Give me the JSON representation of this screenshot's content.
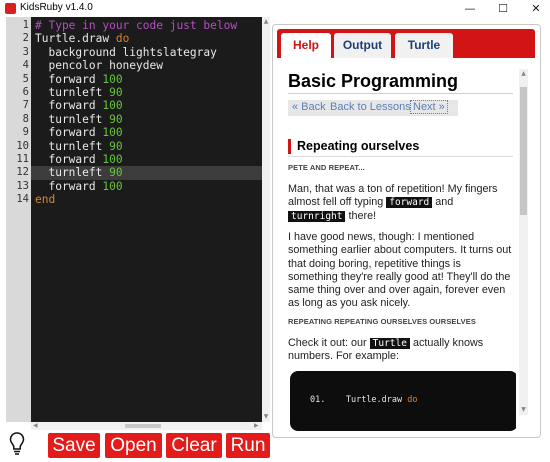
{
  "window": {
    "title": "KidsRuby v1.4.0",
    "controls": {
      "minimize": "—",
      "maximize": "☐",
      "close": "✕"
    }
  },
  "editor": {
    "line_numbers": [
      "1",
      "2",
      "3",
      "4",
      "5",
      "6",
      "7",
      "8",
      "9",
      "10",
      "11",
      "12",
      "13",
      "14"
    ],
    "lines": [
      [
        {
          "t": "# Type in your code just below",
          "c": "comment"
        }
      ],
      [
        {
          "t": "Turtle.draw ",
          "c": "plain"
        },
        {
          "t": "do",
          "c": "keyword"
        }
      ],
      [
        {
          "t": "  background lightslategray",
          "c": "plain"
        }
      ],
      [
        {
          "t": "  pencolor honeydew",
          "c": "plain"
        }
      ],
      [
        {
          "t": "  forward ",
          "c": "plain"
        },
        {
          "t": "100",
          "c": "number"
        }
      ],
      [
        {
          "t": "  turnleft ",
          "c": "plain"
        },
        {
          "t": "90",
          "c": "number"
        }
      ],
      [
        {
          "t": "  forward ",
          "c": "plain"
        },
        {
          "t": "100",
          "c": "number"
        }
      ],
      [
        {
          "t": "  turnleft ",
          "c": "plain"
        },
        {
          "t": "90",
          "c": "number"
        }
      ],
      [
        {
          "t": "  forward ",
          "c": "plain"
        },
        {
          "t": "100",
          "c": "number"
        }
      ],
      [
        {
          "t": "  turnleft ",
          "c": "plain"
        },
        {
          "t": "90",
          "c": "number"
        }
      ],
      [
        {
          "t": "  forward ",
          "c": "plain"
        },
        {
          "t": "100",
          "c": "number"
        }
      ],
      [
        {
          "t": "  turnleft ",
          "c": "plain"
        },
        {
          "t": "90",
          "c": "number"
        }
      ],
      [
        {
          "t": "  forward ",
          "c": "plain"
        },
        {
          "t": "100",
          "c": "number"
        }
      ],
      [
        {
          "t": "end",
          "c": "keyword"
        }
      ]
    ],
    "highlighted_line": 12
  },
  "toolbar": {
    "bulb_icon": "lightbulb-icon",
    "save_label": "Save",
    "open_label": "Open",
    "clear_label": "Clear",
    "run_label": "Run",
    "button_color": "#e31b1b"
  },
  "panel": {
    "tabs": [
      {
        "label": "Help",
        "active": true
      },
      {
        "label": "Output",
        "active": false
      },
      {
        "label": "Turtle",
        "active": false
      }
    ],
    "accent_color": "#d21414",
    "content": {
      "title": "Basic Programming",
      "nav": {
        "back": "« Back",
        "lessons": "Back to Lessons",
        "next": "Next »"
      },
      "section_title": "Repeating ourselves",
      "sub1": "PETE AND REPEAT...",
      "p1_a": "Man, that was a ton of repetition! My fingers almost fell off typing ",
      "p1_code1": "forward",
      "p1_b": " and ",
      "p1_code2": "turnright",
      "p1_c": " there!",
      "p2": "I have good news, though: I mentioned something earlier about computers. It turns out that doing boring, repetitive things is something they're really good at! They'll do the same thing over and over again, forever even as long as you ask nicely.",
      "sub2": "REPEATING REPEATING OURSELVES OURSELVES",
      "p3_a": "Check it out: our ",
      "p3_code": "Turtle",
      "p3_b": " actually knows numbers. For example:",
      "codeblock": {
        "num": "01.",
        "text": "Turtle.draw ",
        "kw": "do"
      }
    }
  }
}
